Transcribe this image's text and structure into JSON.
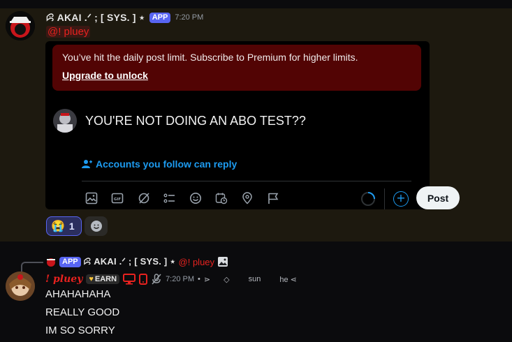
{
  "message1": {
    "username": "ꕸ AKAI .ᐟ ; [ SYS. ] ⋆",
    "app_badge": "APP",
    "timestamp": "7:20 PM",
    "mention": "@! pluey",
    "card": {
      "limit_message": "You’ve hit the daily post limit. Subscribe to Premium for higher limits.",
      "limit_link": "Upgrade to unlock",
      "tweet_text": "YOU'RE NOT DOING AN ABO TEST??",
      "reply_setting": "Accounts you follow can reply",
      "post_button": "Post",
      "toolbar_icons": [
        "image-icon",
        "gif-icon",
        "grok-icon",
        "list-icon",
        "emoji-icon",
        "schedule-icon",
        "location-icon",
        "flag-icon"
      ]
    },
    "reactions": [
      {
        "emoji": "😭",
        "count": "1"
      },
      {
        "emoji": "add-reaction-icon"
      }
    ]
  },
  "message2": {
    "reply_to": {
      "app_badge": "APP",
      "username": "ꕸ AKAI .ᐟ ; [ SYS. ] ⋆",
      "mention": "@! pluey"
    },
    "username": "! pluey",
    "earn_badge": "EARN",
    "timestamp": "7:20 PM",
    "decorations": [
      "⋗",
      "◇",
      "sun",
      "he ⋖"
    ],
    "lines": [
      "AHAHAHAHA",
      "REALLY GOOD",
      "IM SO SORRY"
    ]
  },
  "colors": {
    "accent_red": "#e8221f",
    "link_blue": "#1d9bf0",
    "app_purple": "#5865f2",
    "limit_bg": "#520404",
    "msg_highlight": "#1d190f"
  }
}
